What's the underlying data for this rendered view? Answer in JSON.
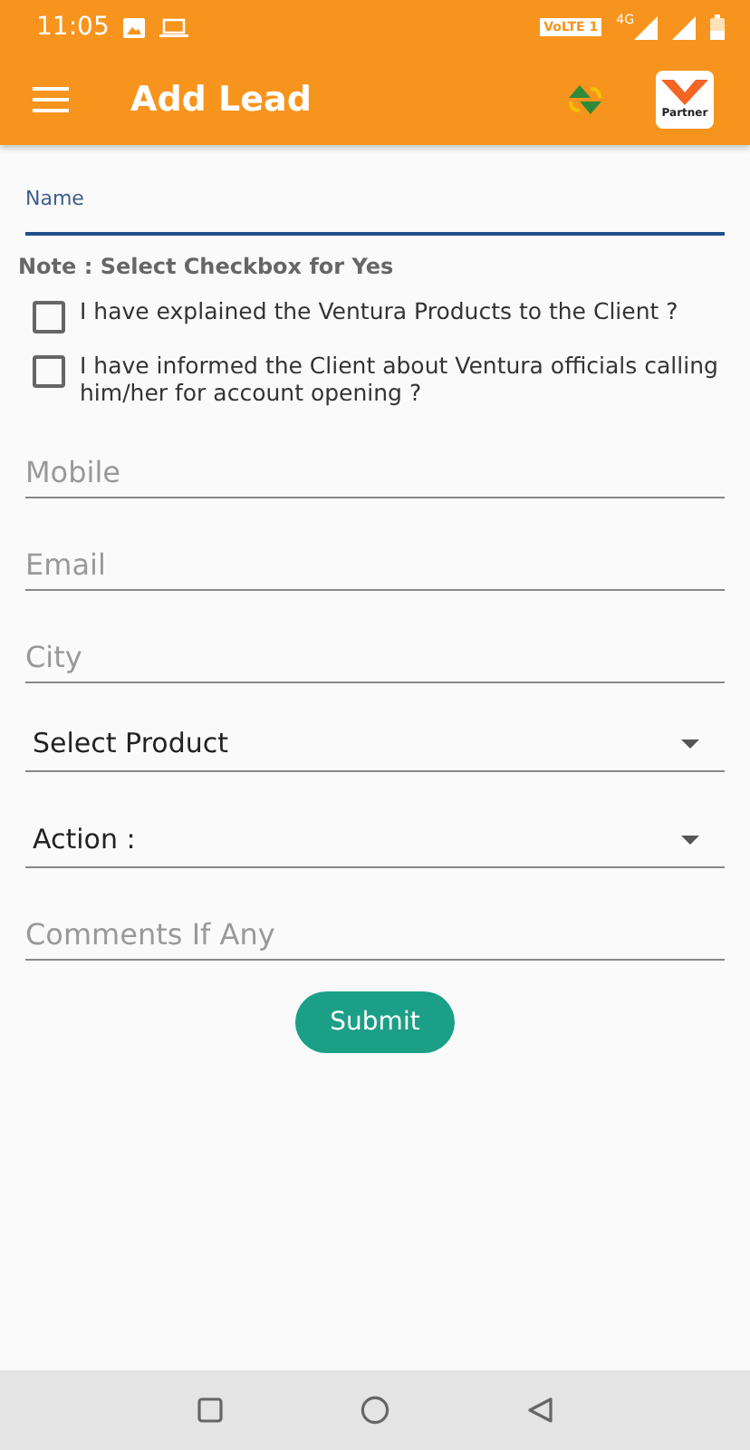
{
  "status_bar": {
    "time": "11:05",
    "network": "VoLTE 1",
    "data": "4G"
  },
  "app_bar": {
    "title": "Add Lead",
    "logo_text": "Partner"
  },
  "name_field": {
    "label": "Name",
    "focused": true
  },
  "note": "Note : Select Checkbox for Yes",
  "checkboxes": [
    {
      "label": "I have explained the Ventura Products to the Client ?",
      "checked": false
    },
    {
      "label": "I have informed the Client about Ventura officials calling him/her for account opening ?",
      "checked": false
    }
  ],
  "fields": [
    {
      "kind": "input",
      "placeholder": "Mobile"
    },
    {
      "kind": "input",
      "placeholder": "Email"
    },
    {
      "kind": "input",
      "placeholder": "City"
    },
    {
      "kind": "select",
      "value": "Select Product"
    },
    {
      "kind": "select",
      "value": "Action :"
    },
    {
      "kind": "input",
      "placeholder": "Comments If Any"
    }
  ],
  "submit": "Submit"
}
